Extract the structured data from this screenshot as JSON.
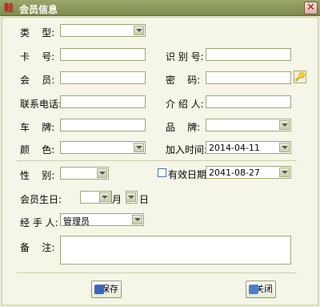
{
  "window": {
    "title": "会员信息",
    "close_icon": "close-icon"
  },
  "fields": {
    "type_label": "类    型:",
    "card_label": "卡    号:",
    "id_label": "识 别 号:",
    "member_label": "会    员:",
    "password_label": "密    码:",
    "phone_label": "联系电话:",
    "introducer_label": "介 绍 人:",
    "plate_label": "车    牌:",
    "brand_label": "品    牌:",
    "color_label": "颜    色:",
    "join_time_label": "加入时间:",
    "join_time_value": "2014-04-11",
    "gender_label": "性    别:",
    "expiry_label": "有效日期:",
    "expiry_value": "2041-08-27",
    "birthday_label": "会员生日:",
    "month_label": "月",
    "day_label": "日",
    "handler_label": "经 手 人:",
    "handler_value": "管理员",
    "remark_label": "备    注:"
  },
  "buttons": {
    "save": "保存",
    "close": "关闭"
  },
  "colors": {
    "title_bg": "#8c9a5a",
    "panel_bg": "#f5f6e8"
  }
}
